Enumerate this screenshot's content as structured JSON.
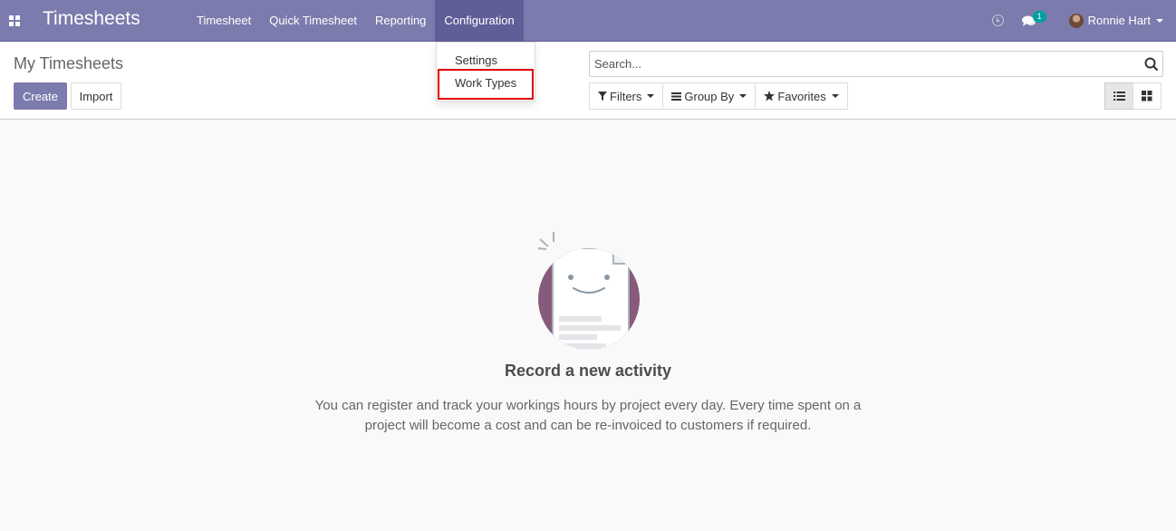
{
  "navbar": {
    "brand": "Timesheets",
    "menu": [
      {
        "label": "Timesheet"
      },
      {
        "label": "Quick Timesheet"
      },
      {
        "label": "Reporting"
      },
      {
        "label": "Configuration"
      }
    ],
    "chat_badge": "1",
    "user_name": "Ronnie Hart",
    "color": "#7c7bad"
  },
  "configuration_menu": {
    "items": [
      {
        "label": "Settings"
      },
      {
        "label": "Work Types"
      }
    ],
    "highlighted": "Work Types",
    "highlight_color": "#e00000"
  },
  "control_panel": {
    "breadcrumb": "My Timesheets",
    "create_label": "Create",
    "import_label": "Import",
    "search_placeholder": "Search...",
    "filters_label": "Filters",
    "group_by_label": "Group By",
    "favorites_label": "Favorites",
    "views": [
      "list",
      "kanban"
    ],
    "active_view": "list"
  },
  "empty_state": {
    "title": "Record a new activity",
    "text": "You can register and track your workings hours by project every day. Every time spent on a project will become a cost and can be re-invoiced to customers if required."
  },
  "icons": [
    "apps-grid-icon",
    "clock-icon",
    "chat-icon",
    "avatar",
    "search-icon",
    "filter-icon",
    "group-by-icon",
    "star-icon",
    "list-view-icon",
    "kanban-view-icon",
    "smiling-document-icon"
  ]
}
